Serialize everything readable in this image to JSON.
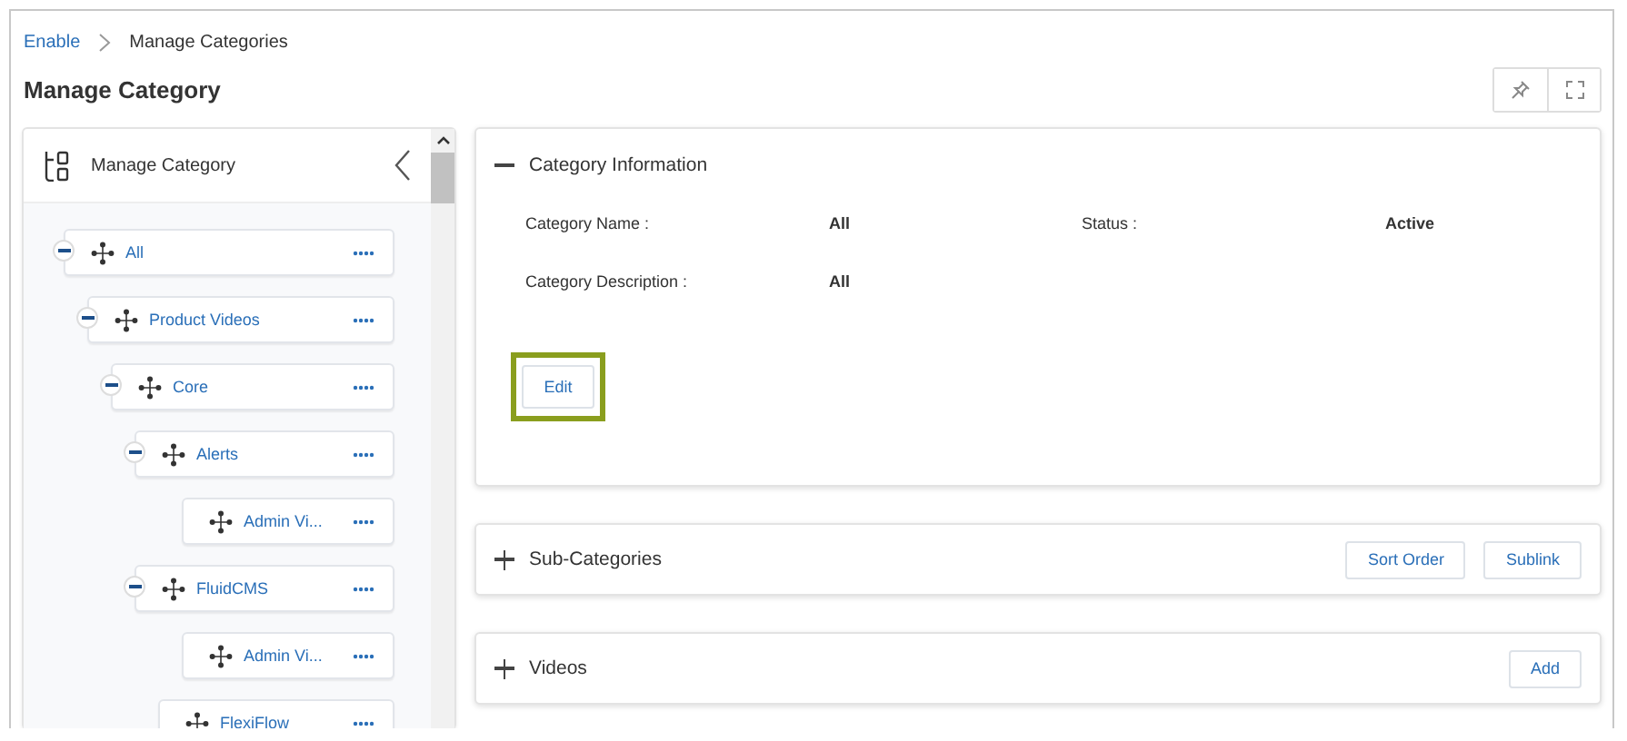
{
  "breadcrumb": [
    {
      "label": "Enable",
      "link": true
    },
    {
      "label": "Manage Categories",
      "link": false
    }
  ],
  "page_title": "Manage Category",
  "sidebar": {
    "title": "Manage Category",
    "tree": [
      {
        "label": "All",
        "expanded": true,
        "children": [
          {
            "label": "Product Videos",
            "expanded": true,
            "children": [
              {
                "label": "Core",
                "expanded": true,
                "children": [
                  {
                    "label": "Alerts",
                    "expanded": true,
                    "children": [
                      {
                        "label": "Admin Vi..."
                      }
                    ]
                  },
                  {
                    "label": "FluidCMS",
                    "expanded": true,
                    "children": [
                      {
                        "label": "Admin Vi..."
                      }
                    ]
                  },
                  {
                    "label": "FlexiFlow"
                  }
                ]
              }
            ]
          }
        ]
      }
    ]
  },
  "info_panel": {
    "title": "Category Information",
    "expanded": true,
    "fields": [
      {
        "label": "Category Name :",
        "value": "All"
      },
      {
        "label": "Status :",
        "value": "Active"
      },
      {
        "label": "Category Description :",
        "value": "All"
      }
    ],
    "edit_button": {
      "label": "Edit",
      "highlighted": true
    }
  },
  "sections": [
    {
      "title": "Sub-Categories",
      "expanded": false,
      "buttons": [
        "Sort Order",
        "Sublink"
      ]
    },
    {
      "title": "Videos",
      "expanded": false,
      "buttons": [
        "Add"
      ]
    }
  ]
}
